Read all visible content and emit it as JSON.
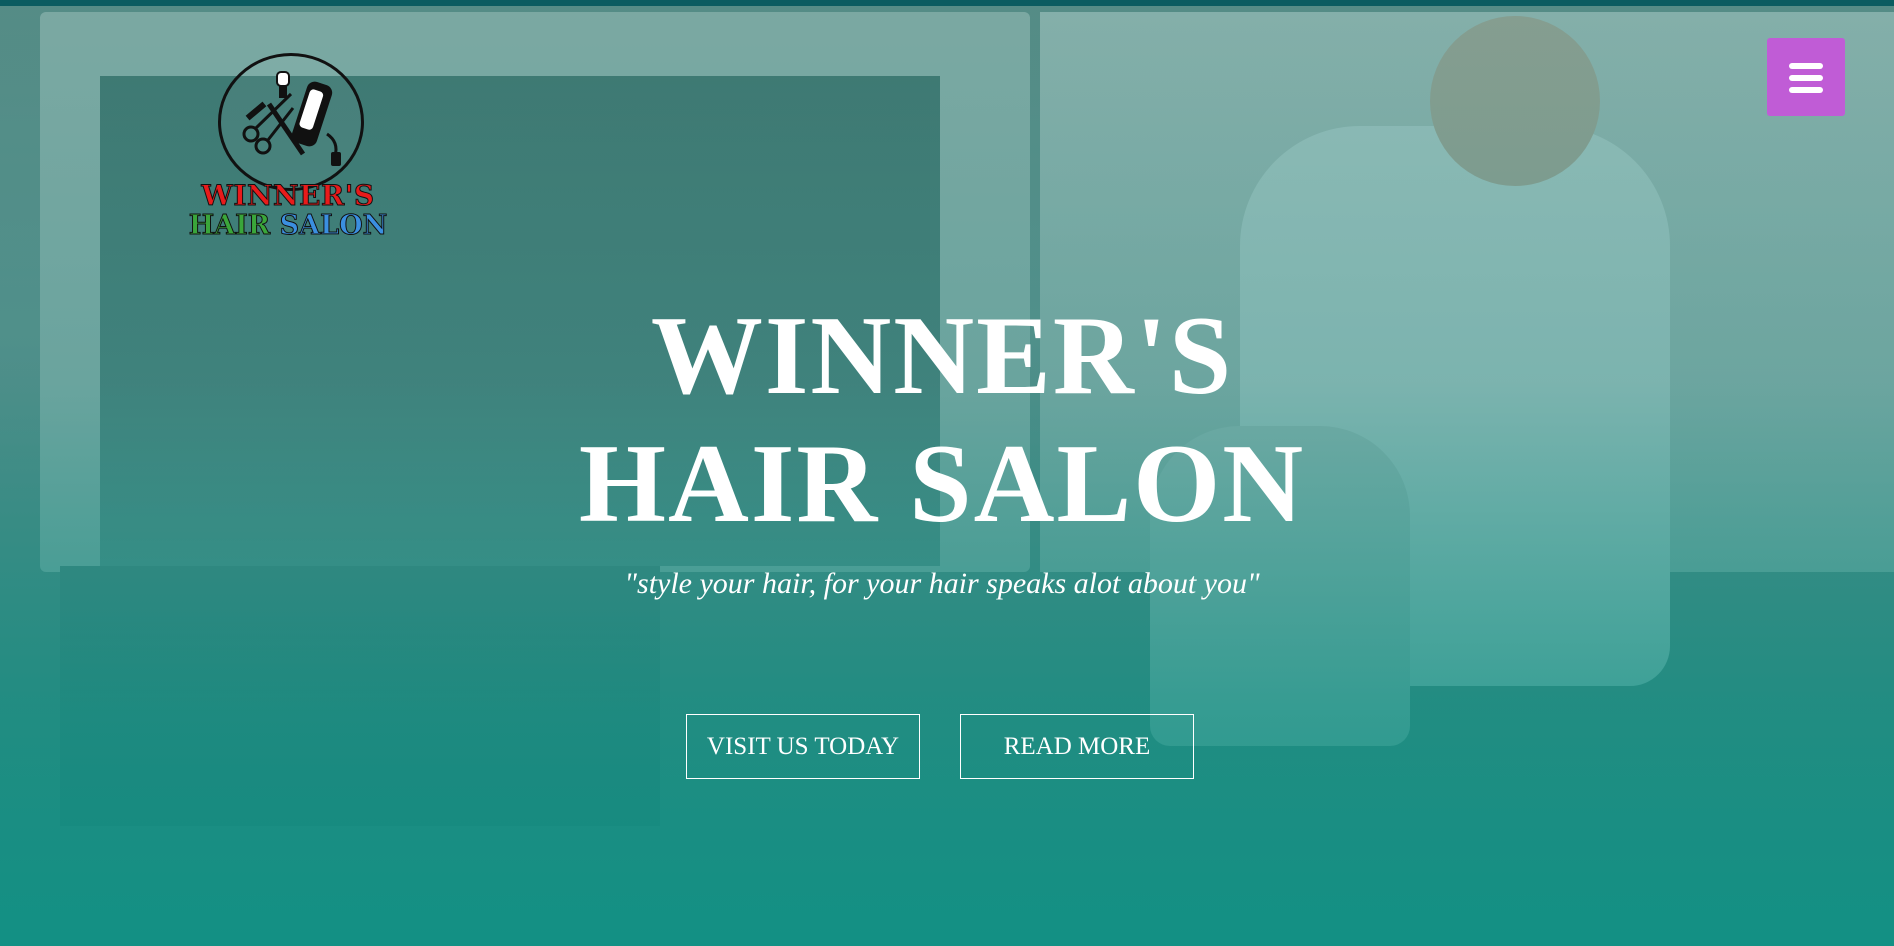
{
  "brand": {
    "logo_line1": "WINNER'S",
    "logo_word_hair": "HAIR",
    "logo_word_salon": "SALON",
    "logo_colors": {
      "line1": "#e81b1b",
      "hair": "#3aa63a",
      "salon": "#3b8fe0"
    },
    "logo_icon": "barber-tools-icon"
  },
  "header": {
    "menu_icon": "hamburger-menu-icon",
    "menu_color": "#c05cd6"
  },
  "hero": {
    "title_line1": "WINNER'S",
    "title_line2": "HAIR SALON",
    "tagline": "\"style your hair, for your hair speaks alot about you\"",
    "overlay_color": "#0c9184"
  },
  "actions": {
    "visit_label": "VISIT US TODAY",
    "read_more_label": "READ MORE"
  }
}
